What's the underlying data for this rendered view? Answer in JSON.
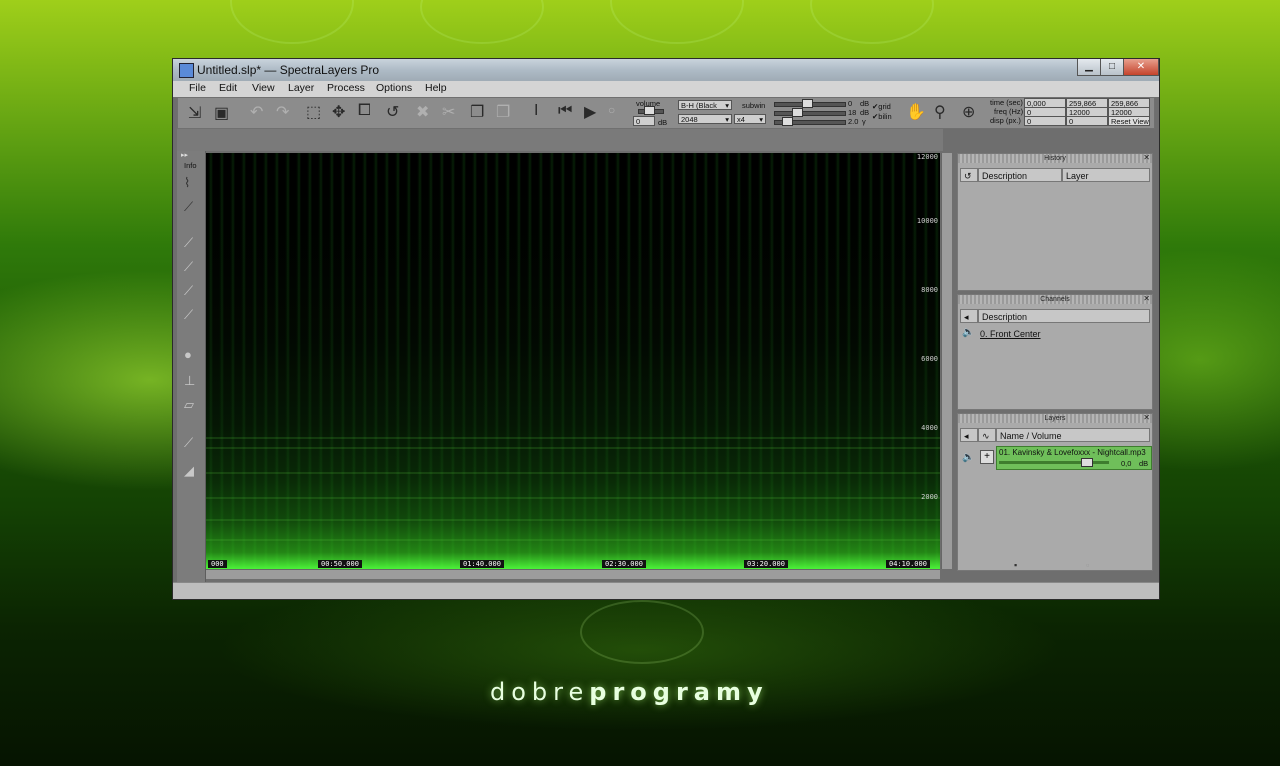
{
  "window": {
    "title": "Untitled.slp* — SpectraLayers Pro"
  },
  "menu": [
    "File",
    "Edit",
    "View",
    "Layer",
    "Process",
    "Options",
    "Help"
  ],
  "toolbar": {
    "volume_label": "volume",
    "volume_value": "0",
    "volume_unit": "dB",
    "colormap": "B-H (Black",
    "fft_size": "2048",
    "subwin_label": "subwin",
    "subwin_value": "x4",
    "slider1_value": "0",
    "slider1_unit": "dB",
    "slider2_value": "18",
    "slider2_unit": "dB",
    "slider3_value": "2.0",
    "slider3_unit": "γ",
    "grid_label": "grid",
    "bilin_label": "bilin",
    "time_label": "time (sec)",
    "freq_label": "freq (Hz)",
    "disp_label": "disp (px.)",
    "time_start": "0,000",
    "time_end": "259,866",
    "time_len": "259,866",
    "freq_start": "0",
    "freq_end": "12000",
    "freq_len": "12000",
    "disp_x": "0",
    "disp_y": "0",
    "reset_view": "Reset View"
  },
  "left_tools": {
    "info_label": "Info"
  },
  "spectrogram": {
    "time_ticks": [
      "000",
      "00:50.000",
      "01:40.000",
      "02:30.000",
      "03:20.000",
      "04:10.000"
    ],
    "freq_ticks": [
      "12000",
      "10000",
      "8000",
      "6000",
      "4000",
      "2000",
      "0"
    ]
  },
  "history": {
    "title": "History",
    "col_description": "Description",
    "col_layer": "Layer"
  },
  "channels": {
    "title": "Channels",
    "col_description": "Description",
    "items": [
      "0. Front Center"
    ]
  },
  "layers": {
    "title": "Layers",
    "col_name": "Name / Volume",
    "items": [
      {
        "name": "01. Kavinsky & Lovefoxxx - Nightcall.mp3",
        "volume": "0,0",
        "unit": "dB",
        "volume_level": 0.82
      }
    ]
  },
  "brand": {
    "light": "dobre",
    "bold": "programy"
  }
}
